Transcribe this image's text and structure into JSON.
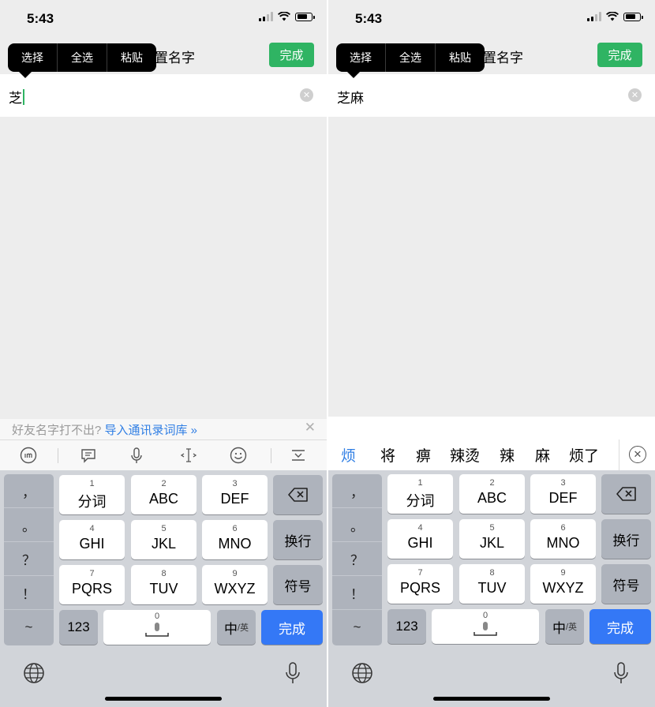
{
  "left": {
    "status": {
      "time": "5:43"
    },
    "nav": {
      "title_visible": "置名字",
      "done": "完成"
    },
    "edit_menu": [
      "选择",
      "全选",
      "粘贴"
    ],
    "field": {
      "text": "芝",
      "clear": "✕"
    },
    "hint": {
      "text": "好友名字打不出?",
      "link": "导入通讯录词库 »",
      "close": "✕"
    },
    "toolbar_icons": [
      "ime-icon",
      "message-icon",
      "microphone-icon",
      "text-cursor-icon",
      "emoji-icon",
      "collapse-keyboard-icon"
    ]
  },
  "right": {
    "status": {
      "time": "5:43"
    },
    "nav": {
      "title_visible": "置名字",
      "done": "完成"
    },
    "edit_menu": [
      "选择",
      "全选",
      "粘贴"
    ],
    "field": {
      "text": "芝麻",
      "clear": "✕"
    },
    "candidates": [
      "烦",
      "将",
      "痹",
      "辣烫",
      "辣",
      "麻",
      "烦了"
    ],
    "candidate_close": "✕"
  },
  "keyboard": {
    "punctuation": [
      "，",
      "。",
      "？",
      "！",
      "~"
    ],
    "rows": [
      [
        {
          "num": "1",
          "label": "分词"
        },
        {
          "num": "2",
          "label": "ABC"
        },
        {
          "num": "3",
          "label": "DEF"
        }
      ],
      [
        {
          "num": "4",
          "label": "GHI"
        },
        {
          "num": "5",
          "label": "JKL"
        },
        {
          "num": "6",
          "label": "MNO"
        }
      ],
      [
        {
          "num": "7",
          "label": "PQRS"
        },
        {
          "num": "8",
          "label": "TUV"
        },
        {
          "num": "9",
          "label": "WXYZ"
        }
      ]
    ],
    "side_keys": {
      "newline": "换行",
      "symbols": "符号"
    },
    "bottom": {
      "num_key": "123",
      "space_num": "0",
      "lang_main": "中",
      "lang_sub": "/英",
      "done": "完成"
    }
  },
  "colors": {
    "accent_green": "#2fb463",
    "keyboard_blue": "#3478f6",
    "link_blue": "#2f7ee4"
  }
}
